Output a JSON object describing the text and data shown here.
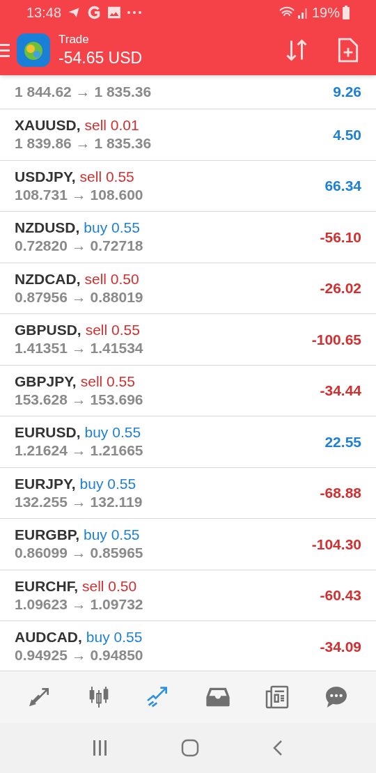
{
  "status_bar": {
    "time": "13:48",
    "battery": "19%"
  },
  "header": {
    "title": "Trade",
    "balance": "-54.65 USD"
  },
  "positions": [
    {
      "prices": "1 844.62 → 1 835.36",
      "profit": "9.26",
      "positive": true
    },
    {
      "symbol": "XAUUSD,",
      "order": "sell 0.01",
      "kind": "sell",
      "prices": "1 839.86 → 1 835.36",
      "profit": "4.50",
      "positive": true
    },
    {
      "symbol": "USDJPY,",
      "order": "sell 0.55",
      "kind": "sell",
      "prices": "108.731 → 108.600",
      "profit": "66.34",
      "positive": true
    },
    {
      "symbol": "NZDUSD,",
      "order": "buy 0.55",
      "kind": "buy",
      "prices": "0.72820 → 0.72718",
      "profit": "-56.10",
      "positive": false
    },
    {
      "symbol": "NZDCAD,",
      "order": "sell 0.50",
      "kind": "sell",
      "prices": "0.87956 → 0.88019",
      "profit": "-26.02",
      "positive": false
    },
    {
      "symbol": "GBPUSD,",
      "order": "sell 0.55",
      "kind": "sell",
      "prices": "1.41351 → 1.41534",
      "profit": "-100.65",
      "positive": false
    },
    {
      "symbol": "GBPJPY,",
      "order": "sell 0.55",
      "kind": "sell",
      "prices": "153.628 → 153.696",
      "profit": "-34.44",
      "positive": false
    },
    {
      "symbol": "EURUSD,",
      "order": "buy 0.55",
      "kind": "buy",
      "prices": "1.21624 → 1.21665",
      "profit": "22.55",
      "positive": true
    },
    {
      "symbol": "EURJPY,",
      "order": "buy 0.55",
      "kind": "buy",
      "prices": "132.255 → 132.119",
      "profit": "-68.88",
      "positive": false
    },
    {
      "symbol": "EURGBP,",
      "order": "buy 0.55",
      "kind": "buy",
      "prices": "0.86099 → 0.85965",
      "profit": "-104.30",
      "positive": false
    },
    {
      "symbol": "EURCHF,",
      "order": "sell 0.50",
      "kind": "sell",
      "prices": "1.09623 → 1.09732",
      "profit": "-60.43",
      "positive": false
    },
    {
      "symbol": "AUDCAD,",
      "order": "buy 0.55",
      "kind": "buy",
      "prices": "0.94925 → 0.94850",
      "profit": "-34.09",
      "positive": false
    }
  ],
  "bottom_nav": [
    {
      "kind": "quotes",
      "selected": false
    },
    {
      "kind": "chart",
      "selected": false
    },
    {
      "kind": "trade",
      "selected": true
    },
    {
      "kind": "mailbox",
      "selected": false
    },
    {
      "kind": "news",
      "selected": false
    },
    {
      "kind": "chat",
      "selected": false
    }
  ]
}
